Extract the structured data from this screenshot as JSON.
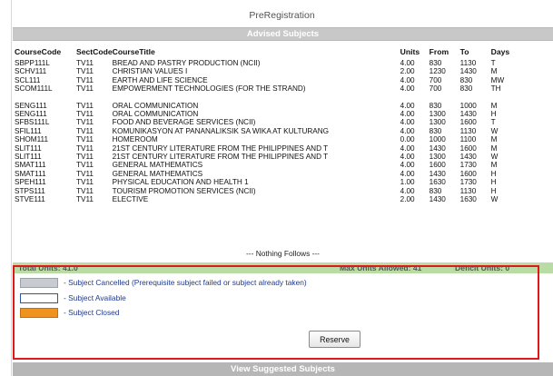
{
  "page": {
    "title": "PreRegistration"
  },
  "advised": {
    "header": "Advised Subjects"
  },
  "table": {
    "columns": [
      "CourseCode",
      "SectCode",
      "CourseTitle",
      "Units",
      "From",
      "To",
      "Days"
    ],
    "group1": [
      [
        "SBPP111L",
        "TV11",
        "BREAD AND PASTRY PRODUCTION (NCII)",
        "4.00",
        "830",
        "1130",
        "T"
      ],
      [
        "SCHV111",
        "TV11",
        "CHRISTIAN VALUES I",
        "2.00",
        "1230",
        "1430",
        "M"
      ],
      [
        "SCL111",
        "TV11",
        "EARTH AND LIFE SCIENCE",
        "4.00",
        "700",
        "830",
        "MW"
      ],
      [
        "SCOM111L",
        "TV11",
        "EMPOWERMENT TECHNOLOGIES (FOR THE STRAND)",
        "4.00",
        "700",
        "830",
        "TH"
      ]
    ],
    "group2": [
      [
        "SENG111",
        "TV11",
        "ORAL COMMUNICATION",
        "4.00",
        "830",
        "1000",
        "M"
      ],
      [
        "SENG111",
        "TV11",
        "ORAL COMMUNICATION",
        "4.00",
        "1300",
        "1430",
        "H"
      ],
      [
        "SFBS111L",
        "TV11",
        "FOOD AND BEVERAGE SERVICES (NCII)",
        "4.00",
        "1300",
        "1600",
        "T"
      ],
      [
        "SFIL111",
        "TV11",
        "KOMUNIKASYON AT PANANALIKSIK SA WIKA AT KULTURANG",
        "4.00",
        "830",
        "1130",
        "W"
      ],
      [
        "SHOM111",
        "TV11",
        "HOMEROOM",
        "0.00",
        "1000",
        "1100",
        "M"
      ],
      [
        "SLIT111",
        "TV11",
        "21ST CENTURY LITERATURE FROM THE PHILIPPINES AND T",
        "4.00",
        "1430",
        "1600",
        "M"
      ],
      [
        "SLIT111",
        "TV11",
        "21ST CENTURY LITERATURE FROM THE PHILIPPINES AND T",
        "4.00",
        "1300",
        "1430",
        "W"
      ],
      [
        "SMAT111",
        "TV11",
        "GENERAL MATHEMATICS",
        "4.00",
        "1600",
        "1730",
        "M"
      ],
      [
        "SMAT111",
        "TV11",
        "GENERAL MATHEMATICS",
        "4.00",
        "1430",
        "1600",
        "H"
      ],
      [
        "SPEH111",
        "TV11",
        "PHYSICAL EDUCATION AND HEALTH 1",
        "1.00",
        "1630",
        "1730",
        "H"
      ],
      [
        "STPS111",
        "TV11",
        "TOURISM PROMOTION SERVICES (NCII)",
        "4.00",
        "830",
        "1130",
        "H"
      ],
      [
        "STVE111",
        "TV11",
        "ELECTIVE",
        "2.00",
        "1430",
        "1630",
        "W"
      ]
    ],
    "footer": "--- Nothing Follows ---"
  },
  "totals": {
    "total_label": "Total Units:  41.0",
    "max_label": "Max Units Allowed:  41",
    "deficit_label": "Deficit Units:  0"
  },
  "legend": {
    "cancelled": "- Subject Cancelled   (Prerequisite subject failed or subject already taken)",
    "available": "- Subject Available",
    "closed": "- Subject Closed"
  },
  "colors": {
    "cancelled_swatch": "#c8cbd0",
    "available_swatch": "#ffffff",
    "closed_swatch": "#f0921e",
    "highlight_border": "#e01818",
    "totals_bar": "#b9dca4"
  },
  "actions": {
    "reserve_label": "Reserve"
  },
  "suggested": {
    "header": "View Suggested Subjects"
  }
}
